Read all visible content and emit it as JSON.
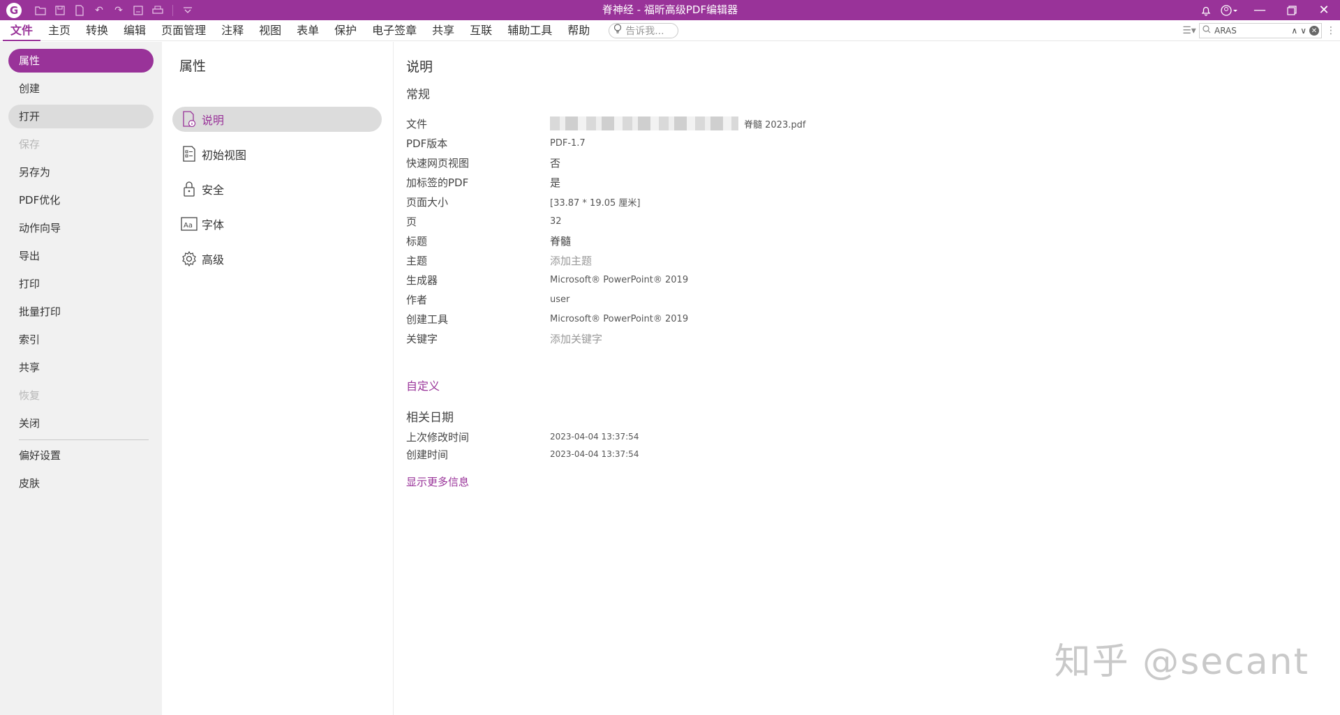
{
  "titlebar": {
    "title": "脊神经 - 福昕高级PDF编辑器",
    "logo_glyph": "G",
    "quick_access_icons": [
      "open-folder-icon",
      "save-icon",
      "new-doc-icon",
      "undo-icon",
      "redo-icon",
      "save-as-icon",
      "print-icon",
      "customize-dropdown-icon"
    ],
    "brand_color": "#993399"
  },
  "menubar": {
    "items": [
      "文件",
      "主页",
      "转换",
      "编辑",
      "页面管理",
      "注释",
      "视图",
      "表单",
      "保护",
      "电子签章",
      "共享",
      "互联",
      "辅助工具",
      "帮助"
    ],
    "tellme_placeholder": "告诉我...",
    "search_value": "ARAS"
  },
  "leftnav": {
    "items": [
      {
        "label": "属性",
        "state": "selected"
      },
      {
        "label": "创建",
        "state": "normal"
      },
      {
        "label": "打开",
        "state": "hover"
      },
      {
        "label": "保存",
        "state": "disabled"
      },
      {
        "label": "另存为",
        "state": "normal"
      },
      {
        "label": "PDF优化",
        "state": "normal"
      },
      {
        "label": "动作向导",
        "state": "normal"
      },
      {
        "label": "导出",
        "state": "normal"
      },
      {
        "label": "打印",
        "state": "normal"
      },
      {
        "label": "批量打印",
        "state": "normal"
      },
      {
        "label": "索引",
        "state": "normal"
      },
      {
        "label": "共享",
        "state": "normal"
      },
      {
        "label": "恢复",
        "state": "disabled"
      },
      {
        "label": "关闭",
        "state": "normal"
      }
    ],
    "bottom_items": [
      "偏好设置",
      "皮肤"
    ]
  },
  "midpanel": {
    "title": "属性",
    "items": [
      {
        "label": "说明",
        "icon": "document-info-icon",
        "selected": true
      },
      {
        "label": "初始视图",
        "icon": "initial-view-icon",
        "selected": false
      },
      {
        "label": "安全",
        "icon": "lock-icon",
        "selected": false
      },
      {
        "label": "字体",
        "icon": "font-icon",
        "selected": false
      },
      {
        "label": "高级",
        "icon": "gear-icon",
        "selected": false
      }
    ]
  },
  "content": {
    "title": "说明",
    "general_heading": "常规",
    "fields": [
      {
        "label": "文件",
        "value": "脊髓 2023.pdf"
      },
      {
        "label": "PDF版本",
        "value": "PDF-1.7"
      },
      {
        "label": "快速网页视图",
        "value": "否"
      },
      {
        "label": "加标签的PDF",
        "value": "是"
      },
      {
        "label": "页面大小",
        "value": "[33.87 * 19.05 厘米]"
      },
      {
        "label": "页",
        "value": "32"
      },
      {
        "label": "标题",
        "value": "脊髓"
      },
      {
        "label": "主题",
        "value": "添加主题"
      },
      {
        "label": "生成器",
        "value": "Microsoft® PowerPoint® 2019"
      },
      {
        "label": "作者",
        "value": "user"
      },
      {
        "label": "创建工具",
        "value": "Microsoft® PowerPoint® 2019"
      },
      {
        "label": "关键字",
        "value": "添加关键字"
      }
    ],
    "custom_link": "自定义",
    "dates_heading": "相关日期",
    "dates": [
      {
        "label": "上次修改时间",
        "value": "2023-04-04 13:37:54"
      },
      {
        "label": "创建时间",
        "value": "2023-04-04 13:37:54"
      }
    ],
    "more_link": "显示更多信息"
  },
  "watermark": "知乎 @secant"
}
